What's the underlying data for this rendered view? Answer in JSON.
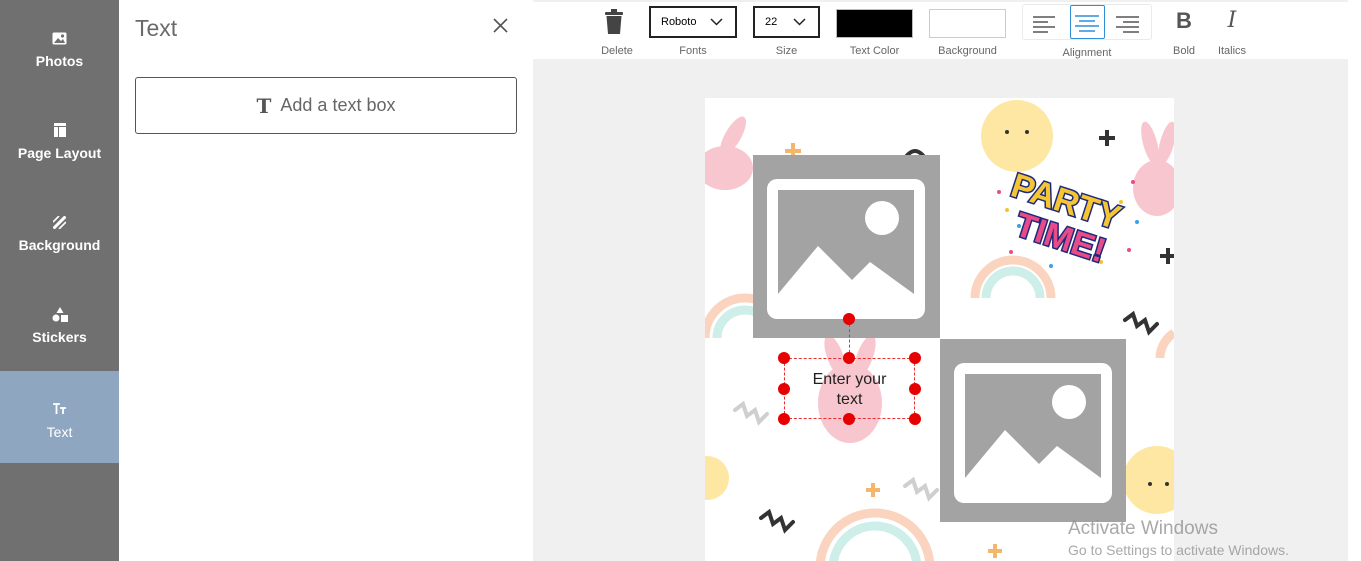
{
  "sidebar": {
    "items": [
      {
        "label": "Photos",
        "icon": "image-icon"
      },
      {
        "label": "Page Layout",
        "icon": "layout-icon"
      },
      {
        "label": "Background",
        "icon": "pattern-icon"
      },
      {
        "label": "Stickers",
        "icon": "shapes-icon"
      },
      {
        "label": "Text",
        "icon": "text-size-icon",
        "active": true
      }
    ]
  },
  "panel": {
    "title": "Text",
    "add_text_label": "Add a text box"
  },
  "toolbar": {
    "delete_label": "Delete",
    "font_value": "Roboto",
    "fonts_label": "Fonts",
    "size_value": "22",
    "size_label": "Size",
    "text_color_label": "Text Color",
    "text_color": "#000000",
    "background_label": "Background",
    "background_color": "#ffffff",
    "alignment_label": "Alignment",
    "alignment_selected": "center",
    "bold_label": "Bold",
    "bold_glyph": "B",
    "italics_label": "Italics",
    "italics_glyph": "I"
  },
  "canvas": {
    "textbox_text_line1": "Enter your",
    "textbox_text_line2": "text",
    "sticker_line1": "PARTY",
    "sticker_line2": "TIME!"
  },
  "watermark": {
    "line1": "Activate Windows",
    "line2": "Go to Settings to activate Windows."
  },
  "colors": {
    "sidebar_bg": "#707070",
    "sidebar_active": "#8fa6c1",
    "workspace_bg": "#f0f0f0",
    "handle": "#e60000",
    "align_active": "#2f8fd8"
  }
}
